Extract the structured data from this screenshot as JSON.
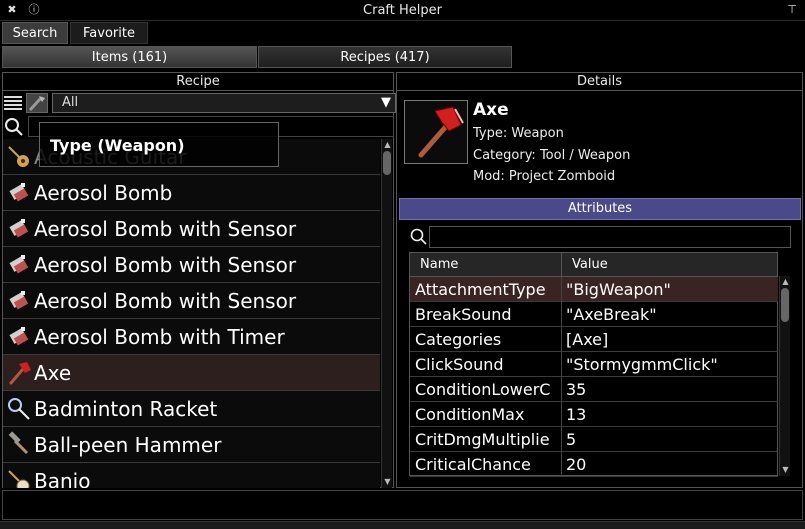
{
  "window": {
    "title": "Craft Helper",
    "close_icon": "close-icon",
    "info_icon": "info-icon",
    "collapse_icon": "collapse-icon"
  },
  "tabs": {
    "search": "Search",
    "favorite": "Favorite"
  },
  "subtabs": {
    "items": "Items (161)",
    "recipes": "Recipes (417)"
  },
  "left_panel": {
    "header": "Recipe",
    "filter_value": "All",
    "tooltip": "Type (Weapon)",
    "items": [
      {
        "label": "Acoustic Guitar",
        "icon": "guitar-icon"
      },
      {
        "label": "Aerosol Bomb",
        "icon": "aerosol-bomb-icon"
      },
      {
        "label": "Aerosol Bomb with Sensor",
        "icon": "aerosol-bomb-icon"
      },
      {
        "label": "Aerosol Bomb with Sensor",
        "icon": "aerosol-bomb-icon"
      },
      {
        "label": "Aerosol Bomb with Sensor",
        "icon": "aerosol-bomb-icon"
      },
      {
        "label": "Aerosol Bomb with Timer",
        "icon": "aerosol-bomb-icon"
      },
      {
        "label": "Axe",
        "icon": "axe-icon"
      },
      {
        "label": "Badminton Racket",
        "icon": "racket-icon"
      },
      {
        "label": "Ball-peen Hammer",
        "icon": "hammer-icon"
      },
      {
        "label": "Banjo",
        "icon": "banjo-icon"
      }
    ]
  },
  "right_panel": {
    "header": "Details",
    "item_name": "Axe",
    "type": "Type: Weapon",
    "category": "Category: Tool / Weapon",
    "mod": "Mod: Project Zomboid",
    "attributes_header": "Attributes",
    "table": {
      "col_name": "Name",
      "col_value": "Value",
      "rows": [
        {
          "name": "AttachmentType",
          "value": "\"BigWeapon\""
        },
        {
          "name": "BreakSound",
          "value": "\"AxeBreak\""
        },
        {
          "name": "Categories",
          "value": "[Axe]"
        },
        {
          "name": "ClickSound",
          "value": "\"StormygmmClick\""
        },
        {
          "name": "ConditionLowerC",
          "value": "35"
        },
        {
          "name": "ConditionMax",
          "value": "13"
        },
        {
          "name": "CritDmgMultiplie",
          "value": "5"
        },
        {
          "name": "CriticalChance",
          "value": "20"
        }
      ]
    }
  },
  "colors": {
    "accent": "#4a4a8a",
    "selected_row": "#2e1f1f",
    "panel_border": "#555555"
  }
}
